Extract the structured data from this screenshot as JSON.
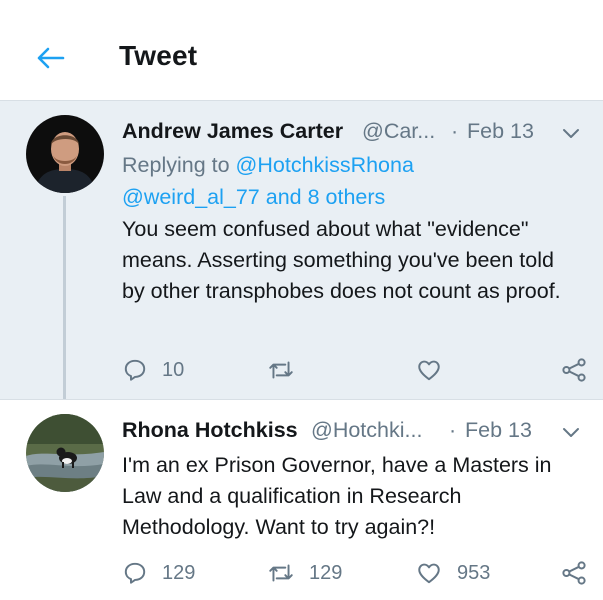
{
  "header": {
    "title": "Tweet",
    "back_icon": "arrow-left-icon"
  },
  "colors": {
    "accent": "#1da1f2",
    "muted": "#657786",
    "text": "#14171a",
    "parent_bg": "#e9eff4"
  },
  "tweets": [
    {
      "name": "Andrew James Carter",
      "handle": "@Car...",
      "separator": "·",
      "date": "Feb 13",
      "replying_prefix": "Replying to ",
      "replying_handle1": "@HotchkissRhona",
      "replying_rest": "@weird_al_77 and 8 others",
      "text": "You seem confused about what \"evidence\" means. Asserting something you've been told by other transphobes does not count as proof.",
      "replies": "10",
      "retweets": "",
      "likes": ""
    },
    {
      "name": "Rhona Hotchkiss",
      "handle": "@Hotchki...",
      "separator": "·",
      "date": "Feb 13",
      "text": "I'm an ex Prison Governor, have a Masters in Law and a qualification in Research Methodology. Want to try again?!",
      "replies": "129",
      "retweets": "129",
      "likes": "953"
    }
  ]
}
